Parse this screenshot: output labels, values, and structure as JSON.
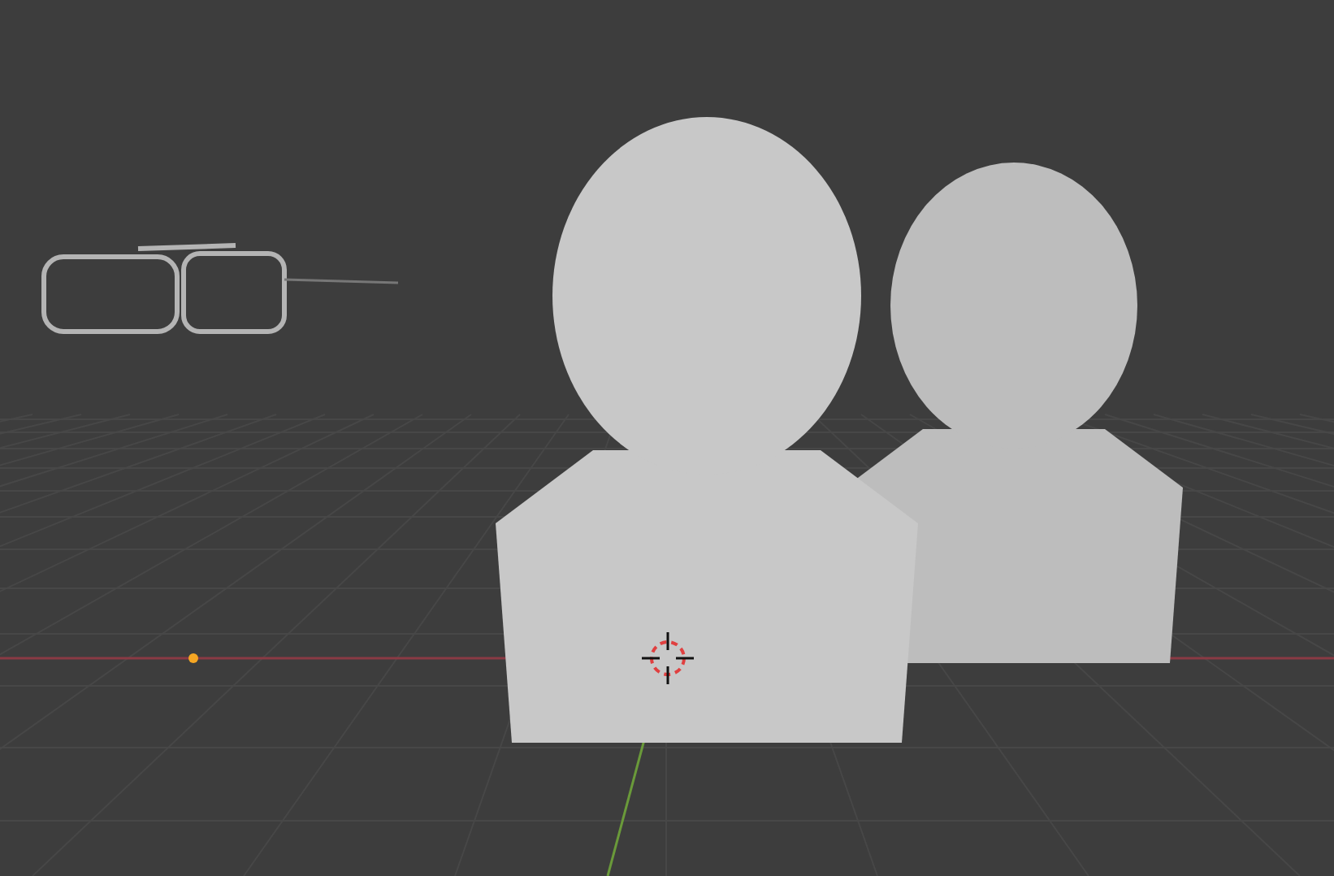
{
  "viewport": {
    "objects": [
      {
        "kind": "glasses"
      },
      {
        "kind": "bust"
      },
      {
        "kind": "bust"
      },
      {
        "kind": "origin"
      },
      {
        "kind": "cursor"
      }
    ]
  }
}
